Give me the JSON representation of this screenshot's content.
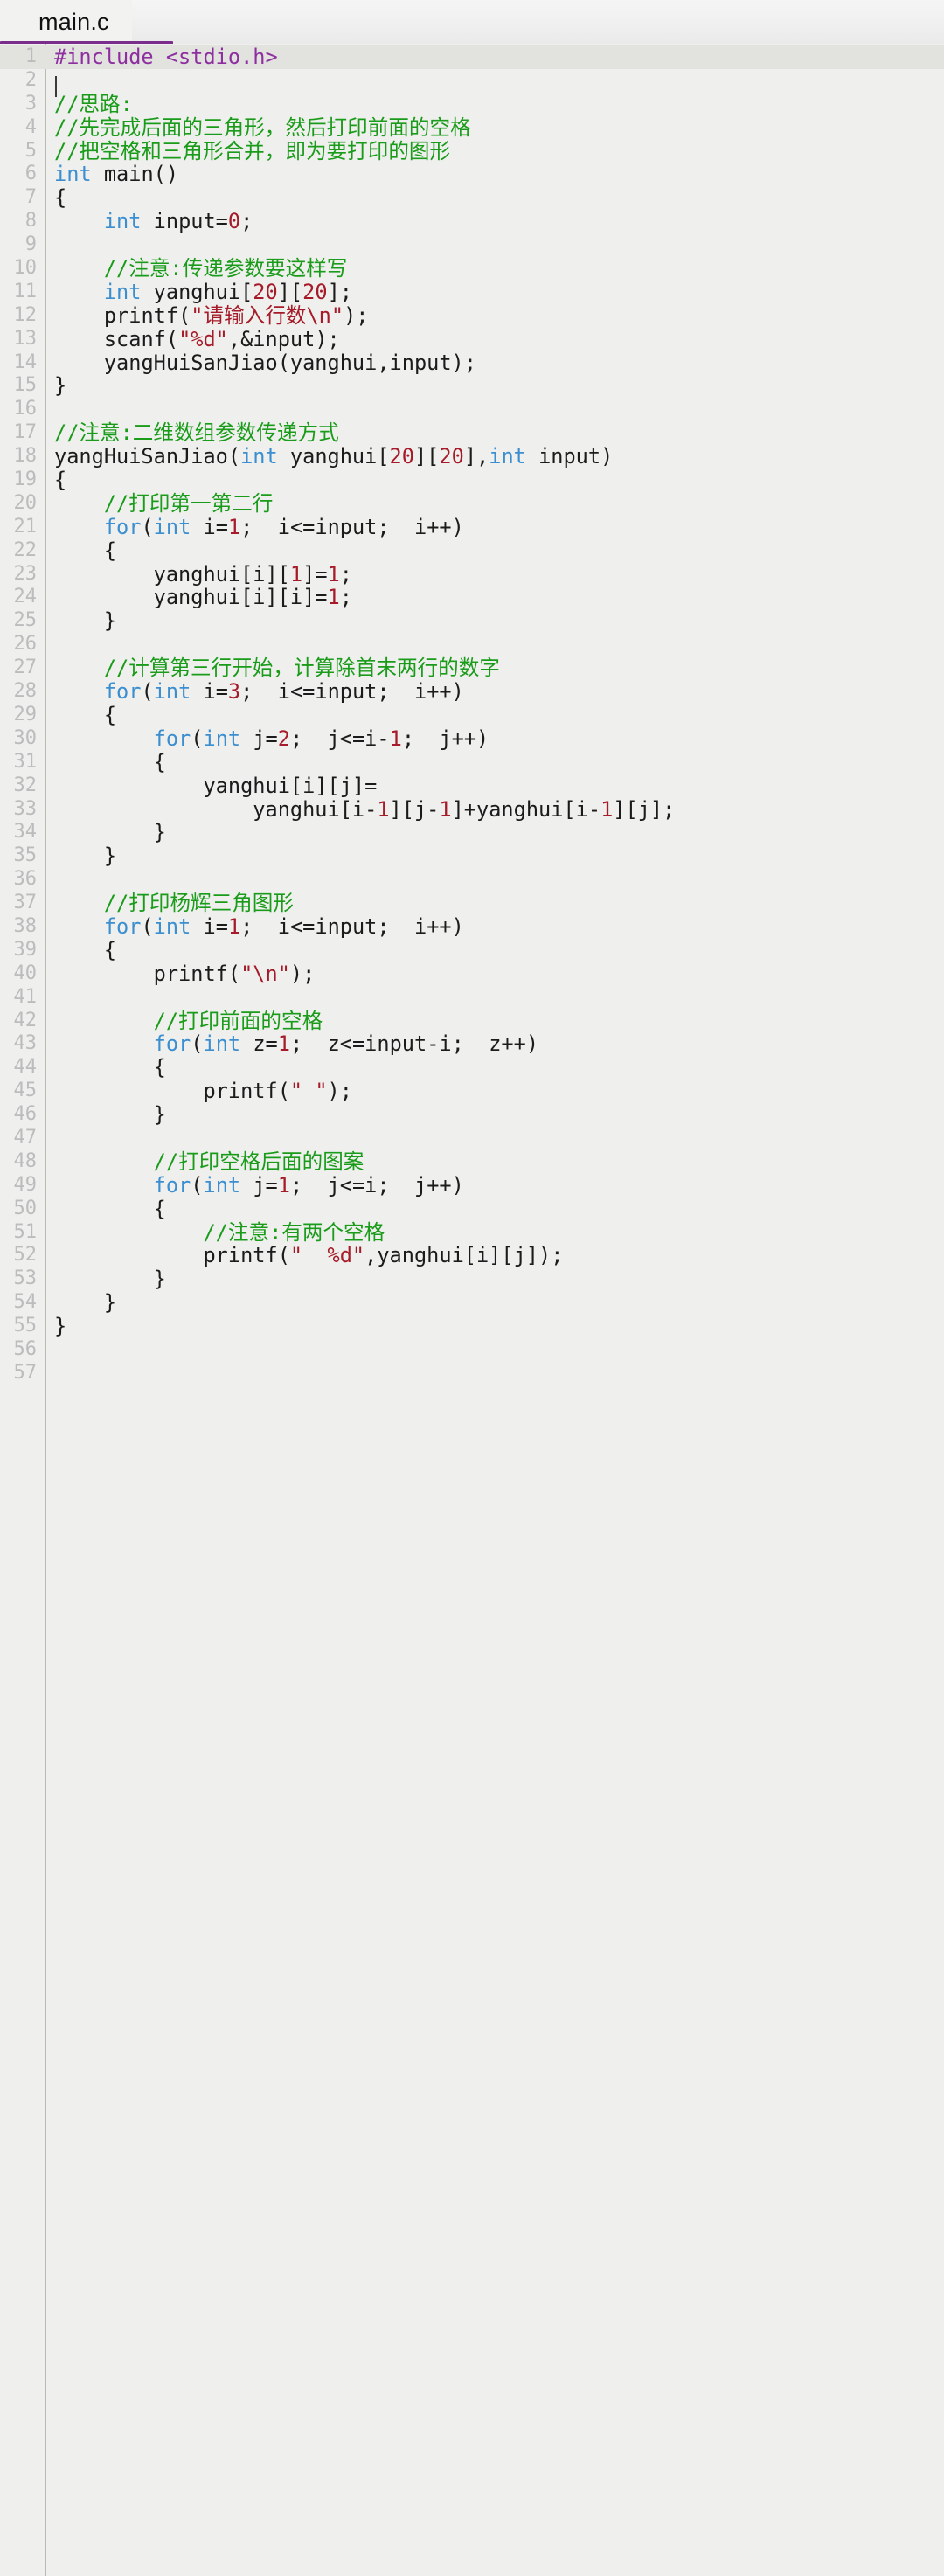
{
  "window": {
    "accent_color": "#7b2d8e",
    "editor_bg": "#eff0ed",
    "current_line_bg": "#e2e3df",
    "gutter_text_color": "#bcbcbc"
  },
  "tabbar": {
    "tabs": [
      {
        "label": "main.c",
        "active": true
      }
    ]
  },
  "editor": {
    "language": "c",
    "current_line": 1,
    "caret_line": 1,
    "caret_column": 1,
    "total_lines": 57,
    "syntax_colors": {
      "preprocessor": "#8e2fa0",
      "comment": "#1a9b1a",
      "keyword": "#3b8ed0",
      "number": "#a61b29",
      "string": "#a61b29",
      "identifier": "#1b1b1b"
    },
    "lines": [
      {
        "n": 1,
        "tokens": [
          {
            "t": "pre",
            "v": "#include <stdio.h>"
          }
        ]
      },
      {
        "n": 2,
        "tokens": []
      },
      {
        "n": 3,
        "tokens": [
          {
            "t": "cmt",
            "v": "//思路:"
          }
        ]
      },
      {
        "n": 4,
        "tokens": [
          {
            "t": "cmt",
            "v": "//先完成后面的三角形，然后打印前面的空格"
          }
        ]
      },
      {
        "n": 5,
        "tokens": [
          {
            "t": "cmt",
            "v": "//把空格和三角形合并，即为要打印的图形"
          }
        ]
      },
      {
        "n": 6,
        "tokens": [
          {
            "t": "kw",
            "v": "int"
          },
          {
            "t": "id",
            "v": " main()"
          }
        ]
      },
      {
        "n": 7,
        "tokens": [
          {
            "t": "pun",
            "v": "{"
          }
        ]
      },
      {
        "n": 8,
        "tokens": [
          {
            "t": "pun",
            "v": "    "
          },
          {
            "t": "kw",
            "v": "int"
          },
          {
            "t": "id",
            "v": " input="
          },
          {
            "t": "num",
            "v": "0"
          },
          {
            "t": "pun",
            "v": ";"
          }
        ]
      },
      {
        "n": 9,
        "tokens": []
      },
      {
        "n": 10,
        "tokens": [
          {
            "t": "pun",
            "v": "    "
          },
          {
            "t": "cmt",
            "v": "//注意:传递参数要这样写"
          }
        ]
      },
      {
        "n": 11,
        "tokens": [
          {
            "t": "pun",
            "v": "    "
          },
          {
            "t": "kw",
            "v": "int"
          },
          {
            "t": "id",
            "v": " yanghui["
          },
          {
            "t": "num",
            "v": "20"
          },
          {
            "t": "id",
            "v": "]["
          },
          {
            "t": "num",
            "v": "20"
          },
          {
            "t": "pun",
            "v": "];"
          }
        ]
      },
      {
        "n": 12,
        "tokens": [
          {
            "t": "pun",
            "v": "    "
          },
          {
            "t": "id",
            "v": "printf("
          },
          {
            "t": "str",
            "v": "\"请输入行数\\n\""
          },
          {
            "t": "pun",
            "v": ");"
          }
        ]
      },
      {
        "n": 13,
        "tokens": [
          {
            "t": "pun",
            "v": "    "
          },
          {
            "t": "id",
            "v": "scanf("
          },
          {
            "t": "str",
            "v": "\"%d\""
          },
          {
            "t": "pun",
            "v": ",&input);"
          }
        ]
      },
      {
        "n": 14,
        "tokens": [
          {
            "t": "pun",
            "v": "    "
          },
          {
            "t": "id",
            "v": "yangHuiSanJiao(yanghui,input);"
          }
        ]
      },
      {
        "n": 15,
        "tokens": [
          {
            "t": "pun",
            "v": "}"
          }
        ]
      },
      {
        "n": 16,
        "tokens": []
      },
      {
        "n": 17,
        "tokens": [
          {
            "t": "cmt",
            "v": "//注意:二维数组参数传递方式"
          }
        ]
      },
      {
        "n": 18,
        "tokens": [
          {
            "t": "id",
            "v": "yangHuiSanJiao("
          },
          {
            "t": "kw",
            "v": "int"
          },
          {
            "t": "id",
            "v": " yanghui["
          },
          {
            "t": "num",
            "v": "20"
          },
          {
            "t": "id",
            "v": "]["
          },
          {
            "t": "num",
            "v": "20"
          },
          {
            "t": "id",
            "v": "],"
          },
          {
            "t": "kw",
            "v": "int"
          },
          {
            "t": "id",
            "v": " input)"
          }
        ]
      },
      {
        "n": 19,
        "tokens": [
          {
            "t": "pun",
            "v": "{"
          }
        ]
      },
      {
        "n": 20,
        "tokens": [
          {
            "t": "pun",
            "v": "    "
          },
          {
            "t": "cmt",
            "v": "//打印第一第二行"
          }
        ]
      },
      {
        "n": 21,
        "tokens": [
          {
            "t": "pun",
            "v": "    "
          },
          {
            "t": "kw",
            "v": "for"
          },
          {
            "t": "pun",
            "v": "("
          },
          {
            "t": "kw",
            "v": "int"
          },
          {
            "t": "id",
            "v": " i="
          },
          {
            "t": "num",
            "v": "1"
          },
          {
            "t": "id",
            "v": ";  i<=input;  i++)"
          }
        ]
      },
      {
        "n": 22,
        "tokens": [
          {
            "t": "pun",
            "v": "    {"
          }
        ]
      },
      {
        "n": 23,
        "tokens": [
          {
            "t": "pun",
            "v": "        "
          },
          {
            "t": "id",
            "v": "yanghui[i]["
          },
          {
            "t": "num",
            "v": "1"
          },
          {
            "t": "id",
            "v": "]="
          },
          {
            "t": "num",
            "v": "1"
          },
          {
            "t": "pun",
            "v": ";"
          }
        ]
      },
      {
        "n": 24,
        "tokens": [
          {
            "t": "pun",
            "v": "        "
          },
          {
            "t": "id",
            "v": "yanghui[i][i]="
          },
          {
            "t": "num",
            "v": "1"
          },
          {
            "t": "pun",
            "v": ";"
          }
        ]
      },
      {
        "n": 25,
        "tokens": [
          {
            "t": "pun",
            "v": "    }"
          }
        ]
      },
      {
        "n": 26,
        "tokens": []
      },
      {
        "n": 27,
        "tokens": [
          {
            "t": "pun",
            "v": "    "
          },
          {
            "t": "cmt",
            "v": "//计算第三行开始，计算除首末两行的数字"
          }
        ]
      },
      {
        "n": 28,
        "tokens": [
          {
            "t": "pun",
            "v": "    "
          },
          {
            "t": "kw",
            "v": "for"
          },
          {
            "t": "pun",
            "v": "("
          },
          {
            "t": "kw",
            "v": "int"
          },
          {
            "t": "id",
            "v": " i="
          },
          {
            "t": "num",
            "v": "3"
          },
          {
            "t": "id",
            "v": ";  i<=input;  i++)"
          }
        ]
      },
      {
        "n": 29,
        "tokens": [
          {
            "t": "pun",
            "v": "    {"
          }
        ]
      },
      {
        "n": 30,
        "tokens": [
          {
            "t": "pun",
            "v": "        "
          },
          {
            "t": "kw",
            "v": "for"
          },
          {
            "t": "pun",
            "v": "("
          },
          {
            "t": "kw",
            "v": "int"
          },
          {
            "t": "id",
            "v": " j="
          },
          {
            "t": "num",
            "v": "2"
          },
          {
            "t": "id",
            "v": ";  j<=i-"
          },
          {
            "t": "num",
            "v": "1"
          },
          {
            "t": "id",
            "v": ";  j++)"
          }
        ]
      },
      {
        "n": 31,
        "tokens": [
          {
            "t": "pun",
            "v": "        {"
          }
        ]
      },
      {
        "n": 32,
        "tokens": [
          {
            "t": "pun",
            "v": "            "
          },
          {
            "t": "id",
            "v": "yanghui[i][j]="
          }
        ]
      },
      {
        "n": 33,
        "tokens": [
          {
            "t": "pun",
            "v": "                "
          },
          {
            "t": "id",
            "v": "yanghui[i-"
          },
          {
            "t": "num",
            "v": "1"
          },
          {
            "t": "id",
            "v": "][j-"
          },
          {
            "t": "num",
            "v": "1"
          },
          {
            "t": "id",
            "v": "]+yanghui[i-"
          },
          {
            "t": "num",
            "v": "1"
          },
          {
            "t": "id",
            "v": "][j];"
          }
        ]
      },
      {
        "n": 34,
        "tokens": [
          {
            "t": "pun",
            "v": "        }"
          }
        ]
      },
      {
        "n": 35,
        "tokens": [
          {
            "t": "pun",
            "v": "    }"
          }
        ]
      },
      {
        "n": 36,
        "tokens": []
      },
      {
        "n": 37,
        "tokens": [
          {
            "t": "pun",
            "v": "    "
          },
          {
            "t": "cmt",
            "v": "//打印杨辉三角图形"
          }
        ]
      },
      {
        "n": 38,
        "tokens": [
          {
            "t": "pun",
            "v": "    "
          },
          {
            "t": "kw",
            "v": "for"
          },
          {
            "t": "pun",
            "v": "("
          },
          {
            "t": "kw",
            "v": "int"
          },
          {
            "t": "id",
            "v": " i="
          },
          {
            "t": "num",
            "v": "1"
          },
          {
            "t": "id",
            "v": ";  i<=input;  i++)"
          }
        ]
      },
      {
        "n": 39,
        "tokens": [
          {
            "t": "pun",
            "v": "    {"
          }
        ]
      },
      {
        "n": 40,
        "tokens": [
          {
            "t": "pun",
            "v": "        "
          },
          {
            "t": "id",
            "v": "printf("
          },
          {
            "t": "str",
            "v": "\"\\n\""
          },
          {
            "t": "pun",
            "v": ");"
          }
        ]
      },
      {
        "n": 41,
        "tokens": []
      },
      {
        "n": 42,
        "tokens": [
          {
            "t": "pun",
            "v": "        "
          },
          {
            "t": "cmt",
            "v": "//打印前面的空格"
          }
        ]
      },
      {
        "n": 43,
        "tokens": [
          {
            "t": "pun",
            "v": "        "
          },
          {
            "t": "kw",
            "v": "for"
          },
          {
            "t": "pun",
            "v": "("
          },
          {
            "t": "kw",
            "v": "int"
          },
          {
            "t": "id",
            "v": " z="
          },
          {
            "t": "num",
            "v": "1"
          },
          {
            "t": "id",
            "v": ";  z<=input-i;  z++)"
          }
        ]
      },
      {
        "n": 44,
        "tokens": [
          {
            "t": "pun",
            "v": "        {"
          }
        ]
      },
      {
        "n": 45,
        "tokens": [
          {
            "t": "pun",
            "v": "            "
          },
          {
            "t": "id",
            "v": "printf("
          },
          {
            "t": "str",
            "v": "\" \""
          },
          {
            "t": "pun",
            "v": ");"
          }
        ]
      },
      {
        "n": 46,
        "tokens": [
          {
            "t": "pun",
            "v": "        }"
          }
        ]
      },
      {
        "n": 47,
        "tokens": []
      },
      {
        "n": 48,
        "tokens": [
          {
            "t": "pun",
            "v": "        "
          },
          {
            "t": "cmt",
            "v": "//打印空格后面的图案"
          }
        ]
      },
      {
        "n": 49,
        "tokens": [
          {
            "t": "pun",
            "v": "        "
          },
          {
            "t": "kw",
            "v": "for"
          },
          {
            "t": "pun",
            "v": "("
          },
          {
            "t": "kw",
            "v": "int"
          },
          {
            "t": "id",
            "v": " j="
          },
          {
            "t": "num",
            "v": "1"
          },
          {
            "t": "id",
            "v": ";  j<=i;  j++)"
          }
        ]
      },
      {
        "n": 50,
        "tokens": [
          {
            "t": "pun",
            "v": "        {"
          }
        ]
      },
      {
        "n": 51,
        "tokens": [
          {
            "t": "pun",
            "v": "            "
          },
          {
            "t": "cmt",
            "v": "//注意:有两个空格"
          }
        ]
      },
      {
        "n": 52,
        "tokens": [
          {
            "t": "pun",
            "v": "            "
          },
          {
            "t": "id",
            "v": "printf("
          },
          {
            "t": "str",
            "v": "\"  %d\""
          },
          {
            "t": "pun",
            "v": ",yanghui[i][j]);"
          }
        ]
      },
      {
        "n": 53,
        "tokens": [
          {
            "t": "pun",
            "v": "        }"
          }
        ]
      },
      {
        "n": 54,
        "tokens": [
          {
            "t": "pun",
            "v": "    }"
          }
        ]
      },
      {
        "n": 55,
        "tokens": [
          {
            "t": "pun",
            "v": "}"
          }
        ]
      },
      {
        "n": 56,
        "tokens": []
      },
      {
        "n": 57,
        "tokens": []
      }
    ]
  }
}
